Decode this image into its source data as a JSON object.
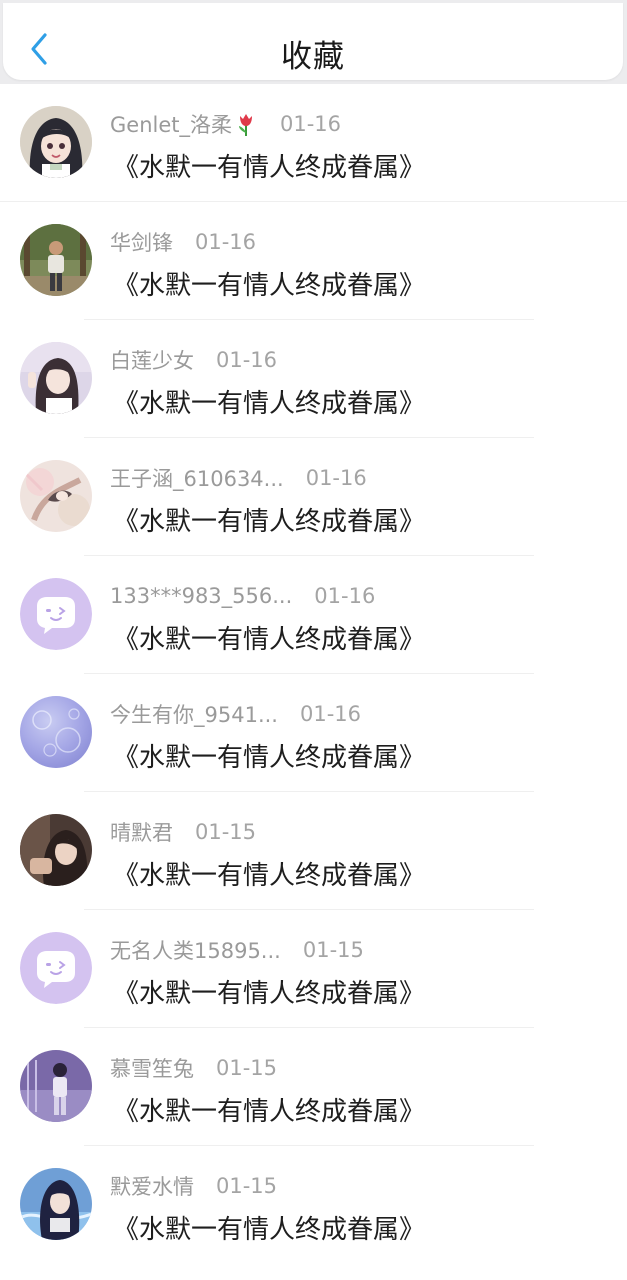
{
  "header": {
    "title": "收藏",
    "back_icon": "chevron-left-icon",
    "accent_color": "#2f9fe6"
  },
  "items": [
    {
      "user": "Genlet_洛柔",
      "date": "01-16",
      "content": "《水默一有情人终成眷属》",
      "avatar": "girl-anime-avatar",
      "emoji_icon": "tulip-icon"
    },
    {
      "user": "华剑锋",
      "date": "01-16",
      "content": "《水默一有情人终成眷属》",
      "avatar": "man-outdoor-avatar"
    },
    {
      "user": "白莲少女",
      "date": "01-16",
      "content": "《水默一有情人终成眷属》",
      "avatar": "girl-photo-avatar"
    },
    {
      "user": "王子涵_610634...",
      "date": "01-16",
      "content": "《水默一有情人终成眷属》",
      "avatar": "painting-avatar"
    },
    {
      "user": "133***983_556...",
      "date": "01-16",
      "content": "《水默一有情人终成眷属》",
      "avatar": "default-chat-avatar"
    },
    {
      "user": "今生有你_9541...",
      "date": "01-16",
      "content": "《水默一有情人终成眷属》",
      "avatar": "bubble-avatar"
    },
    {
      "user": "晴默君",
      "date": "01-15",
      "content": "《水默一有情人终成眷属》",
      "avatar": "woman-photo-avatar"
    },
    {
      "user": "无名人类15895...",
      "date": "01-15",
      "content": "《水默一有情人终成眷属》",
      "avatar": "default-chat-avatar"
    },
    {
      "user": "慕雪笙兔",
      "date": "01-15",
      "content": "《水默一有情人终成眷属》",
      "avatar": "purple-photo-avatar"
    },
    {
      "user": "默爱水情",
      "date": "01-15",
      "content": "《水默一有情人终成眷属》",
      "avatar": "anime-blue-avatar"
    }
  ]
}
